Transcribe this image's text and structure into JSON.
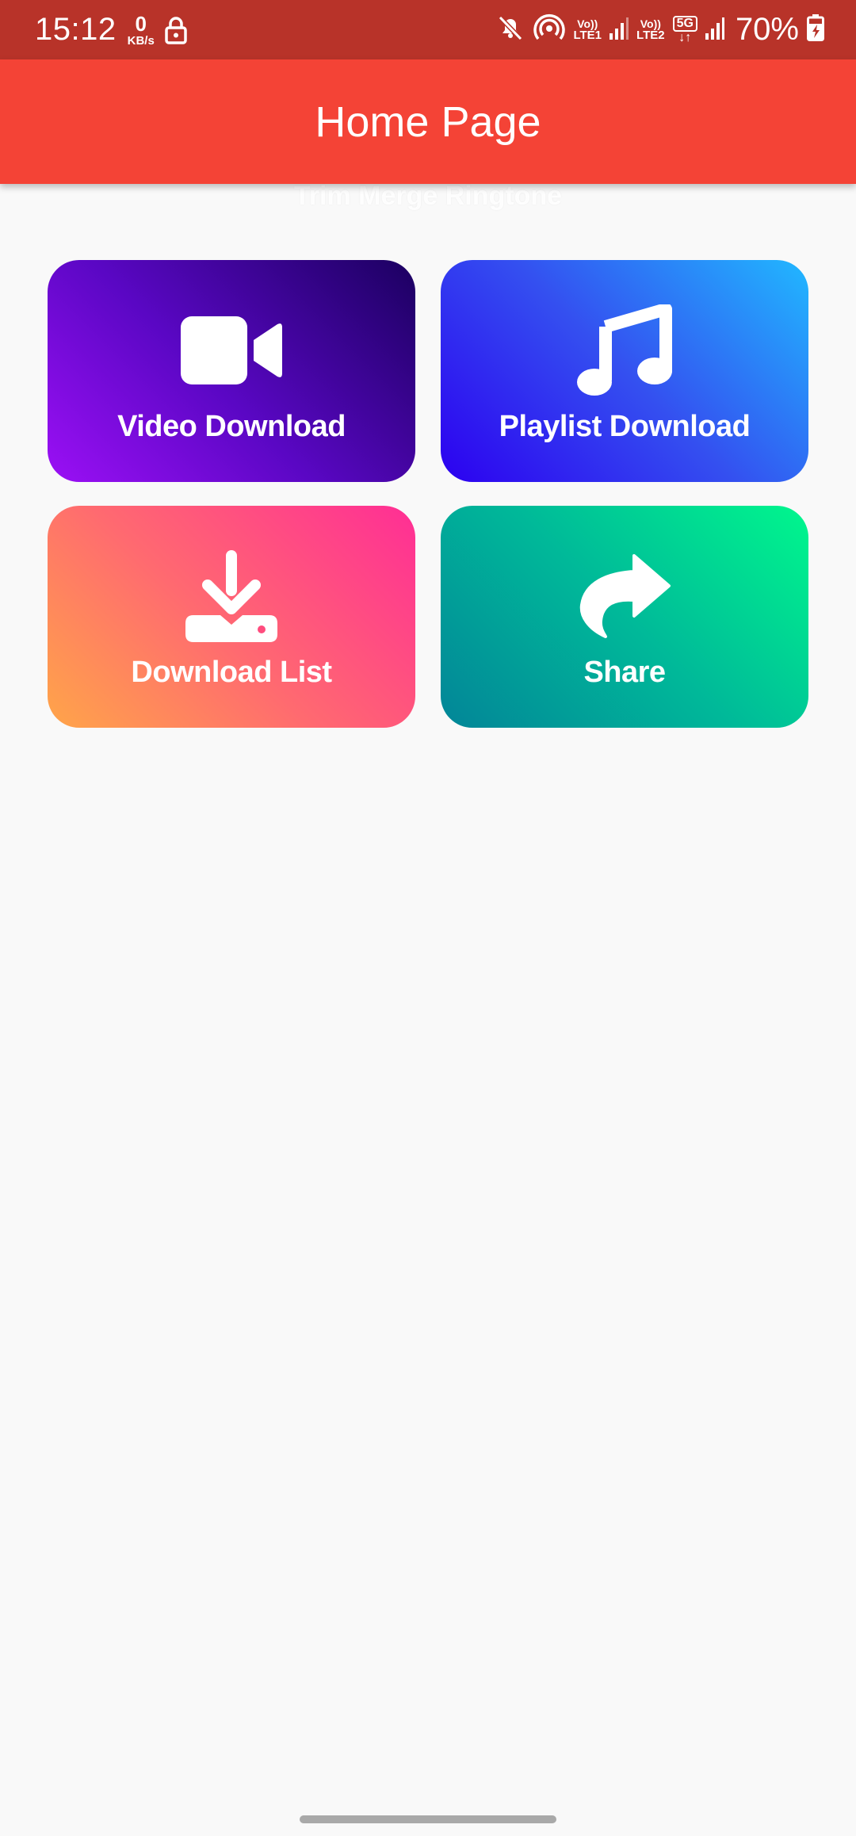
{
  "status_bar": {
    "time": "15:12",
    "net_speed_value": "0",
    "net_speed_unit": "KB/s",
    "sim1_top": "Vo))",
    "sim1_bottom": "LTE1",
    "sim2_top": "Vo))",
    "sim2_bottom": "LTE2",
    "network_type": "5G",
    "network_arrows": "↓↑",
    "battery_text": "70%",
    "battery_level": 0.7,
    "icons": [
      "lock-icon",
      "mute-icon",
      "hotspot-icon",
      "signal-icon",
      "battery-charging-icon"
    ]
  },
  "app_bar": {
    "title": "Home Page",
    "color": "#f44336"
  },
  "ghost_text": "Trim Merge Ringtone",
  "cards": [
    {
      "label": "Video Download",
      "icon": "video-camera-icon"
    },
    {
      "label": "Playlist Download",
      "icon": "music-note-icon"
    },
    {
      "label": "Download List",
      "icon": "download-tray-icon"
    },
    {
      "label": "Share",
      "icon": "share-arrow-icon"
    }
  ]
}
